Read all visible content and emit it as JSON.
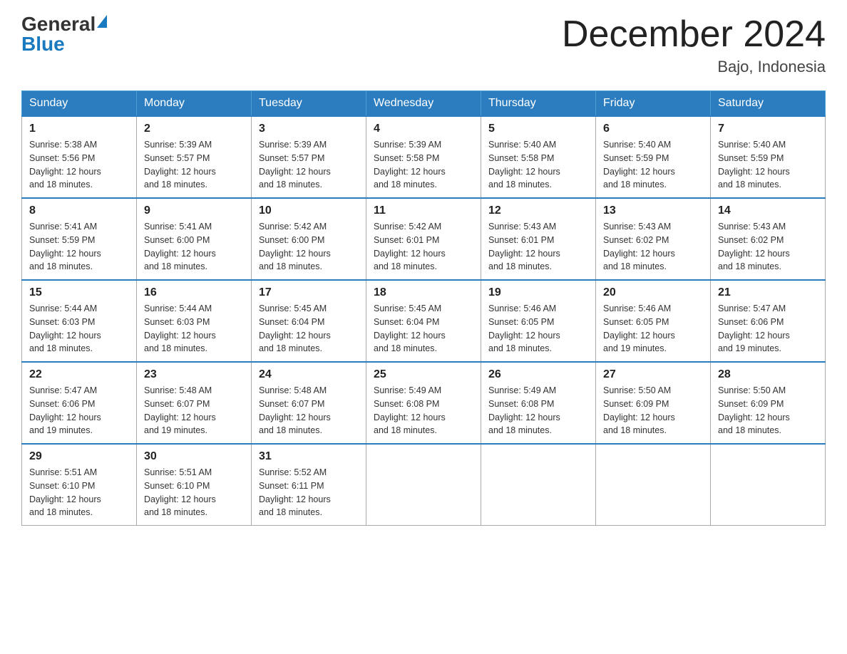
{
  "header": {
    "logo_general": "General",
    "logo_blue": "Blue",
    "month_title": "December 2024",
    "location": "Bajo, Indonesia"
  },
  "weekdays": [
    "Sunday",
    "Monday",
    "Tuesday",
    "Wednesday",
    "Thursday",
    "Friday",
    "Saturday"
  ],
  "weeks": [
    [
      {
        "day": "1",
        "sunrise": "5:38 AM",
        "sunset": "5:56 PM",
        "daylight": "12 hours and 18 minutes."
      },
      {
        "day": "2",
        "sunrise": "5:39 AM",
        "sunset": "5:57 PM",
        "daylight": "12 hours and 18 minutes."
      },
      {
        "day": "3",
        "sunrise": "5:39 AM",
        "sunset": "5:57 PM",
        "daylight": "12 hours and 18 minutes."
      },
      {
        "day": "4",
        "sunrise": "5:39 AM",
        "sunset": "5:58 PM",
        "daylight": "12 hours and 18 minutes."
      },
      {
        "day": "5",
        "sunrise": "5:40 AM",
        "sunset": "5:58 PM",
        "daylight": "12 hours and 18 minutes."
      },
      {
        "day": "6",
        "sunrise": "5:40 AM",
        "sunset": "5:59 PM",
        "daylight": "12 hours and 18 minutes."
      },
      {
        "day": "7",
        "sunrise": "5:40 AM",
        "sunset": "5:59 PM",
        "daylight": "12 hours and 18 minutes."
      }
    ],
    [
      {
        "day": "8",
        "sunrise": "5:41 AM",
        "sunset": "5:59 PM",
        "daylight": "12 hours and 18 minutes."
      },
      {
        "day": "9",
        "sunrise": "5:41 AM",
        "sunset": "6:00 PM",
        "daylight": "12 hours and 18 minutes."
      },
      {
        "day": "10",
        "sunrise": "5:42 AM",
        "sunset": "6:00 PM",
        "daylight": "12 hours and 18 minutes."
      },
      {
        "day": "11",
        "sunrise": "5:42 AM",
        "sunset": "6:01 PM",
        "daylight": "12 hours and 18 minutes."
      },
      {
        "day": "12",
        "sunrise": "5:43 AM",
        "sunset": "6:01 PM",
        "daylight": "12 hours and 18 minutes."
      },
      {
        "day": "13",
        "sunrise": "5:43 AM",
        "sunset": "6:02 PM",
        "daylight": "12 hours and 18 minutes."
      },
      {
        "day": "14",
        "sunrise": "5:43 AM",
        "sunset": "6:02 PM",
        "daylight": "12 hours and 18 minutes."
      }
    ],
    [
      {
        "day": "15",
        "sunrise": "5:44 AM",
        "sunset": "6:03 PM",
        "daylight": "12 hours and 18 minutes."
      },
      {
        "day": "16",
        "sunrise": "5:44 AM",
        "sunset": "6:03 PM",
        "daylight": "12 hours and 18 minutes."
      },
      {
        "day": "17",
        "sunrise": "5:45 AM",
        "sunset": "6:04 PM",
        "daylight": "12 hours and 18 minutes."
      },
      {
        "day": "18",
        "sunrise": "5:45 AM",
        "sunset": "6:04 PM",
        "daylight": "12 hours and 18 minutes."
      },
      {
        "day": "19",
        "sunrise": "5:46 AM",
        "sunset": "6:05 PM",
        "daylight": "12 hours and 18 minutes."
      },
      {
        "day": "20",
        "sunrise": "5:46 AM",
        "sunset": "6:05 PM",
        "daylight": "12 hours and 19 minutes."
      },
      {
        "day": "21",
        "sunrise": "5:47 AM",
        "sunset": "6:06 PM",
        "daylight": "12 hours and 19 minutes."
      }
    ],
    [
      {
        "day": "22",
        "sunrise": "5:47 AM",
        "sunset": "6:06 PM",
        "daylight": "12 hours and 19 minutes."
      },
      {
        "day": "23",
        "sunrise": "5:48 AM",
        "sunset": "6:07 PM",
        "daylight": "12 hours and 19 minutes."
      },
      {
        "day": "24",
        "sunrise": "5:48 AM",
        "sunset": "6:07 PM",
        "daylight": "12 hours and 18 minutes."
      },
      {
        "day": "25",
        "sunrise": "5:49 AM",
        "sunset": "6:08 PM",
        "daylight": "12 hours and 18 minutes."
      },
      {
        "day": "26",
        "sunrise": "5:49 AM",
        "sunset": "6:08 PM",
        "daylight": "12 hours and 18 minutes."
      },
      {
        "day": "27",
        "sunrise": "5:50 AM",
        "sunset": "6:09 PM",
        "daylight": "12 hours and 18 minutes."
      },
      {
        "day": "28",
        "sunrise": "5:50 AM",
        "sunset": "6:09 PM",
        "daylight": "12 hours and 18 minutes."
      }
    ],
    [
      {
        "day": "29",
        "sunrise": "5:51 AM",
        "sunset": "6:10 PM",
        "daylight": "12 hours and 18 minutes."
      },
      {
        "day": "30",
        "sunrise": "5:51 AM",
        "sunset": "6:10 PM",
        "daylight": "12 hours and 18 minutes."
      },
      {
        "day": "31",
        "sunrise": "5:52 AM",
        "sunset": "6:11 PM",
        "daylight": "12 hours and 18 minutes."
      },
      null,
      null,
      null,
      null
    ]
  ],
  "sunrise_label": "Sunrise:",
  "sunset_label": "Sunset:",
  "daylight_label": "Daylight:"
}
